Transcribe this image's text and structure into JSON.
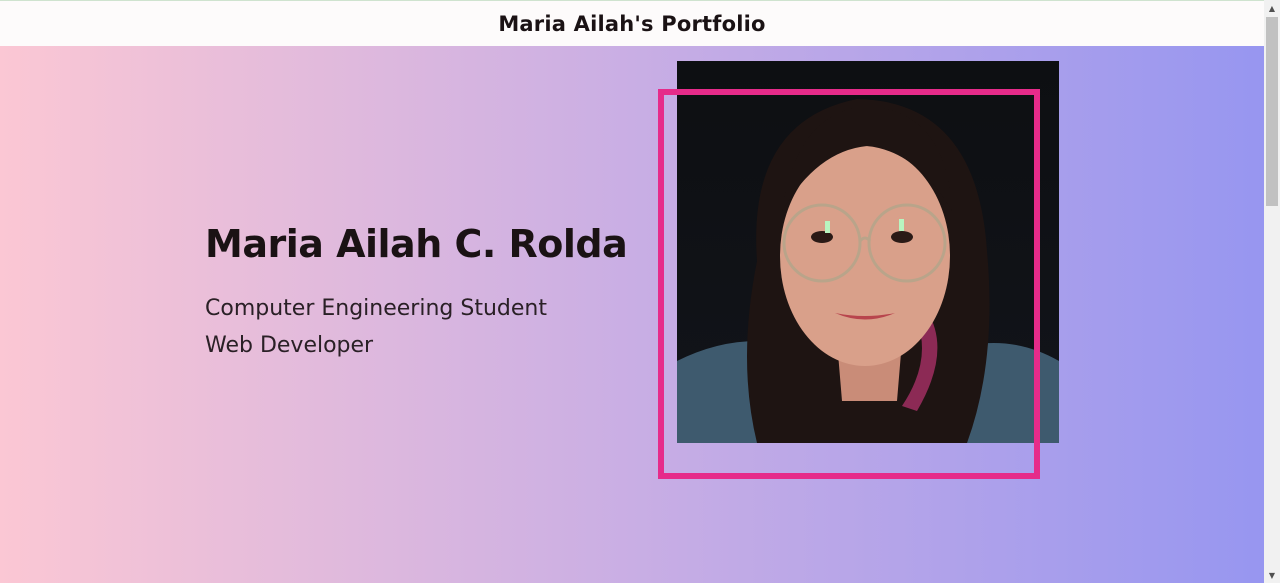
{
  "header": {
    "title": "Maria Ailah's Portfolio"
  },
  "hero": {
    "name": "Maria Ailah C. Rolda",
    "roles": [
      "Computer Engineering Student",
      "Web Developer"
    ],
    "photo_icon": "portrait-photo"
  },
  "colors": {
    "gradient_start": "#fbc7d4",
    "gradient_mid": "#c9aee4",
    "gradient_end": "#9796f0",
    "frame_accent": "#e62b8a",
    "text_dark": "#1a1214"
  },
  "scrollbar": {
    "up_icon": "▲",
    "down_icon": "▼"
  }
}
